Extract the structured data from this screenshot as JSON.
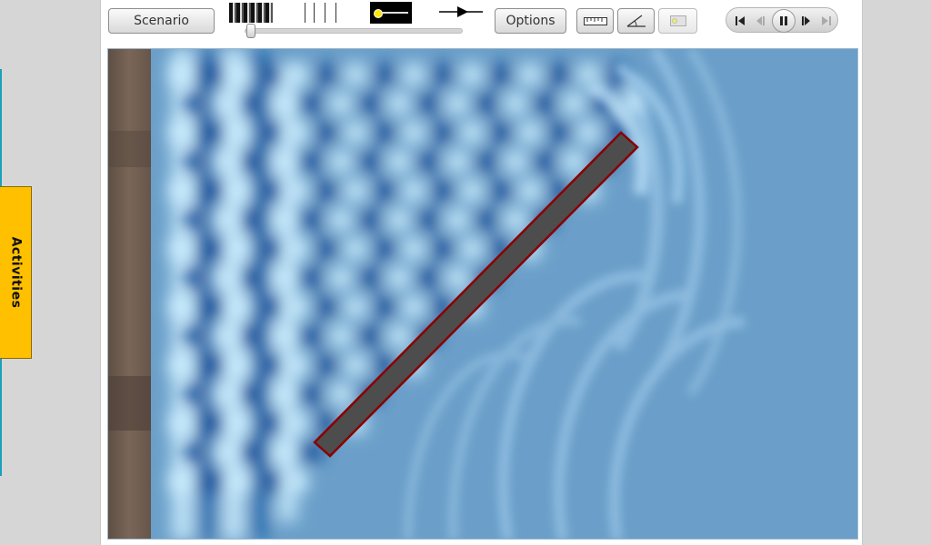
{
  "sidebar": {
    "activities_label": "Activities"
  },
  "toolbar": {
    "scenario_label": "Scenario",
    "options_label": "Options",
    "frequency_icon": "frequency-stripes-icon",
    "amplitude_icon": "amplitude-lines-icon",
    "source_icon": "wave-source-icon",
    "direction_icon": "direction-arrow-icon",
    "tools": [
      {
        "name": "ruler-icon"
      },
      {
        "name": "protractor-icon"
      },
      {
        "name": "detector-icon"
      }
    ]
  },
  "slider": {
    "value_fraction": 0.02
  },
  "playback": {
    "buttons": [
      "skip-to-start-icon",
      "step-back-icon",
      "pause-icon",
      "step-forward-icon",
      "skip-to-end-icon"
    ],
    "state": "playing"
  },
  "simulation": {
    "barrier_color": "#4d4d4d",
    "barrier_outline": "#8b0000",
    "water_color": "#6b9fc9",
    "wave_crest_color": "#cdefff",
    "wave_trough_color": "#0a4e96",
    "wall_color": "#6e5a4d"
  }
}
